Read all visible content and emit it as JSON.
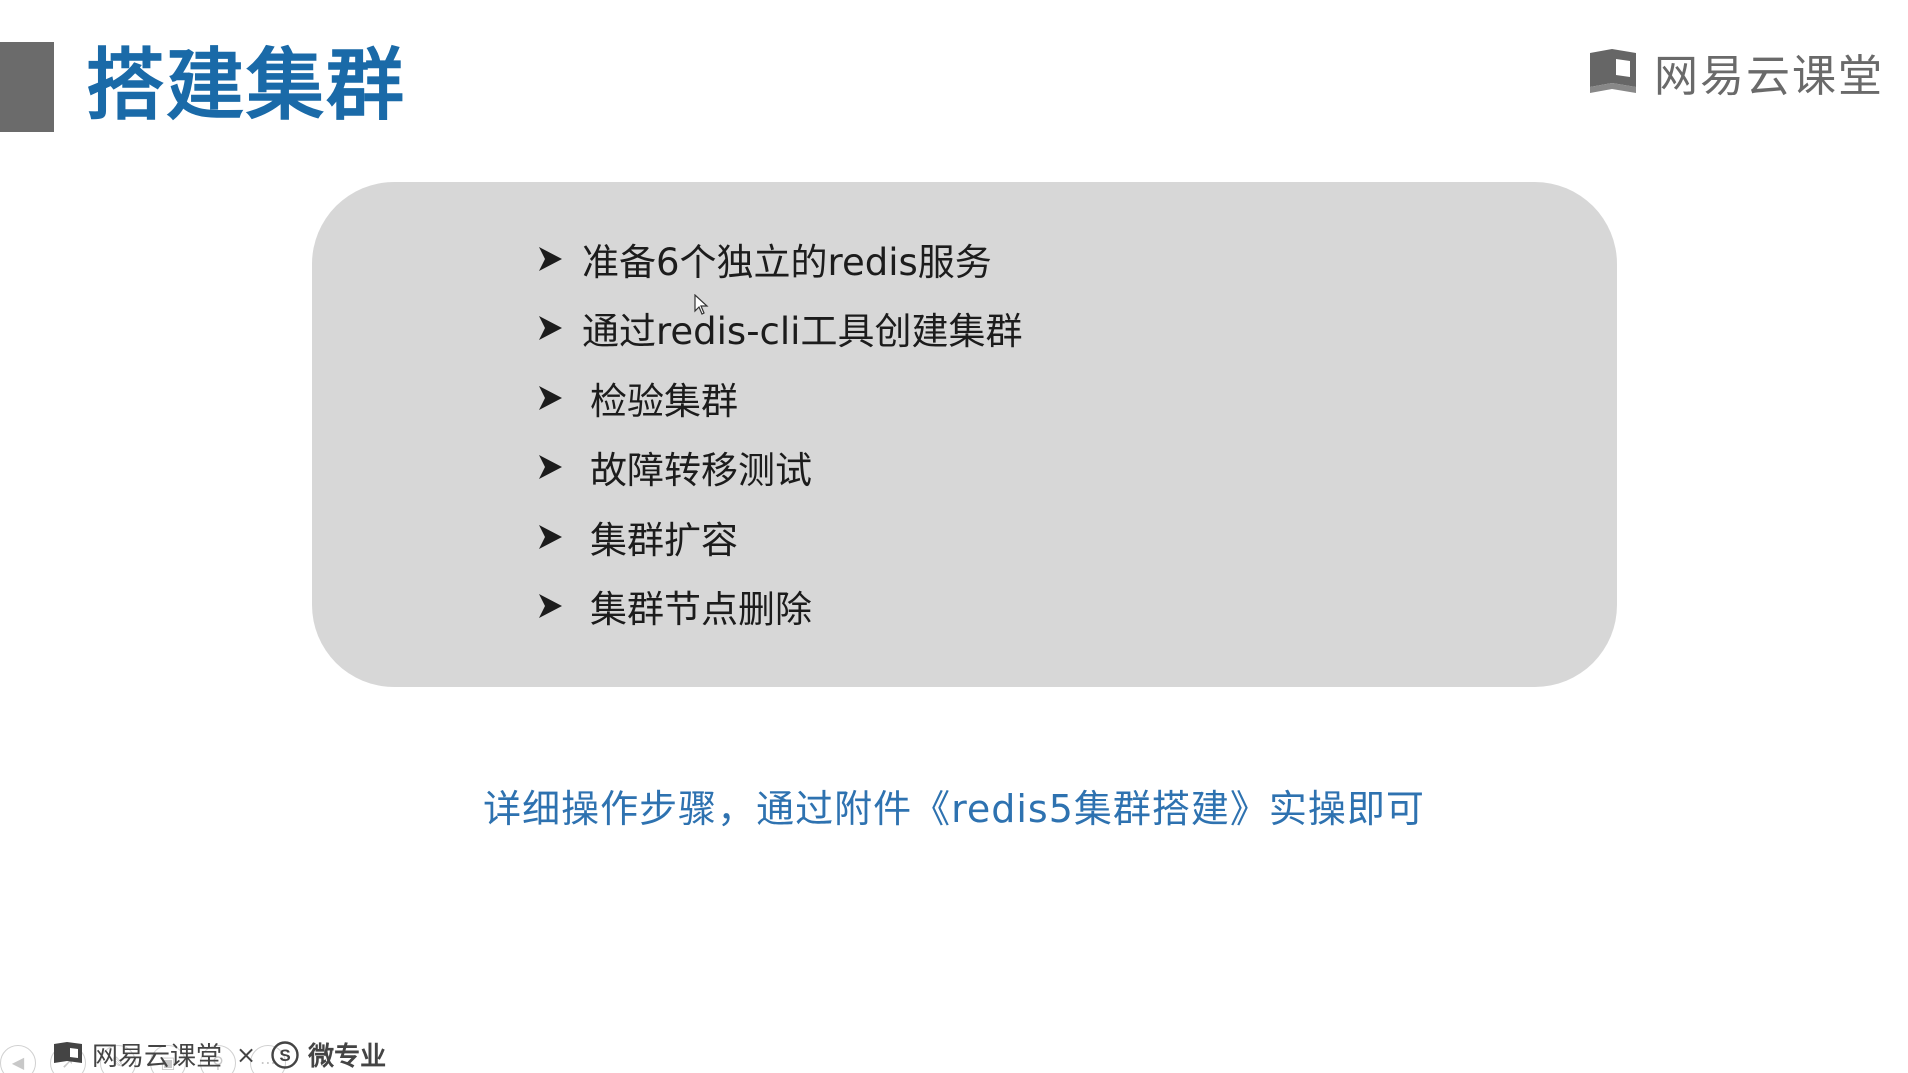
{
  "slide": {
    "title": "搭建集群",
    "brand_top": "网易云课堂",
    "bullets": [
      "准备6个独立的redis服务",
      "通过redis-cli工具创建集群",
      "检验集群",
      "故障转移测试",
      "集群扩容",
      "集群节点删除"
    ],
    "note": "详细操作步骤，通过附件《redis5集群搭建》实操即可"
  },
  "footer": {
    "brand": "网易云课堂",
    "times": "×",
    "partner": "微专业"
  },
  "colors": {
    "title": "#1a6aa8",
    "note": "#2e72b0",
    "box": "#d7d7d7",
    "accent_bar": "#6b6b6b"
  },
  "icons": {
    "bullet": "arrowhead-right-icon",
    "brand": "book-icon",
    "partner": "s-circle-icon",
    "cursor": "mouse-pointer-icon"
  },
  "player_controls": [
    "prev",
    "next",
    "pen",
    "copy",
    "zoom",
    "more"
  ]
}
